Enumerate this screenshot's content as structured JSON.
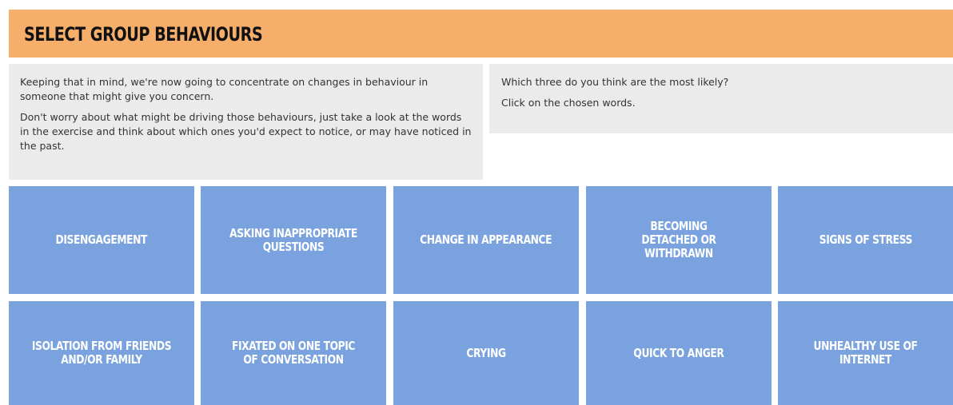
{
  "header": {
    "title": "SELECT GROUP BEHAVIOURS"
  },
  "intro": {
    "paragraph1": "Keeping that in mind, we're now going to concentrate on changes in behaviour in someone that might give you concern.",
    "paragraph2": "Don't worry about what might be driving those behaviours, just take a look at the words in the exercise and think about which ones you'd expect to notice, or may have noticed in the past."
  },
  "instructions": {
    "question": "Which three do you think are the most likely?",
    "action": "Click on the chosen words."
  },
  "options": [
    {
      "label": "DISENGAGEMENT"
    },
    {
      "label": "ASKING INAPPROPRIATE QUESTIONS"
    },
    {
      "label": "CHANGE IN APPEARANCE"
    },
    {
      "label": "BECOMING DETACHED OR WITHDRAWN"
    },
    {
      "label": "SIGNS OF STRESS"
    },
    {
      "label": "ISOLATION FROM FRIENDS AND/OR FAMILY"
    },
    {
      "label": "FIXATED ON ONE TOPIC OF CONVERSATION"
    },
    {
      "label": "CRYING"
    },
    {
      "label": "QUICK TO ANGER"
    },
    {
      "label": "UNHEALTHY USE OF INTERNET"
    }
  ],
  "colors": {
    "header_bg": "#f6ae6b",
    "panel_bg": "#ebebeb",
    "tile_bg": "#7aa2de",
    "tile_text": "#ffffff"
  }
}
